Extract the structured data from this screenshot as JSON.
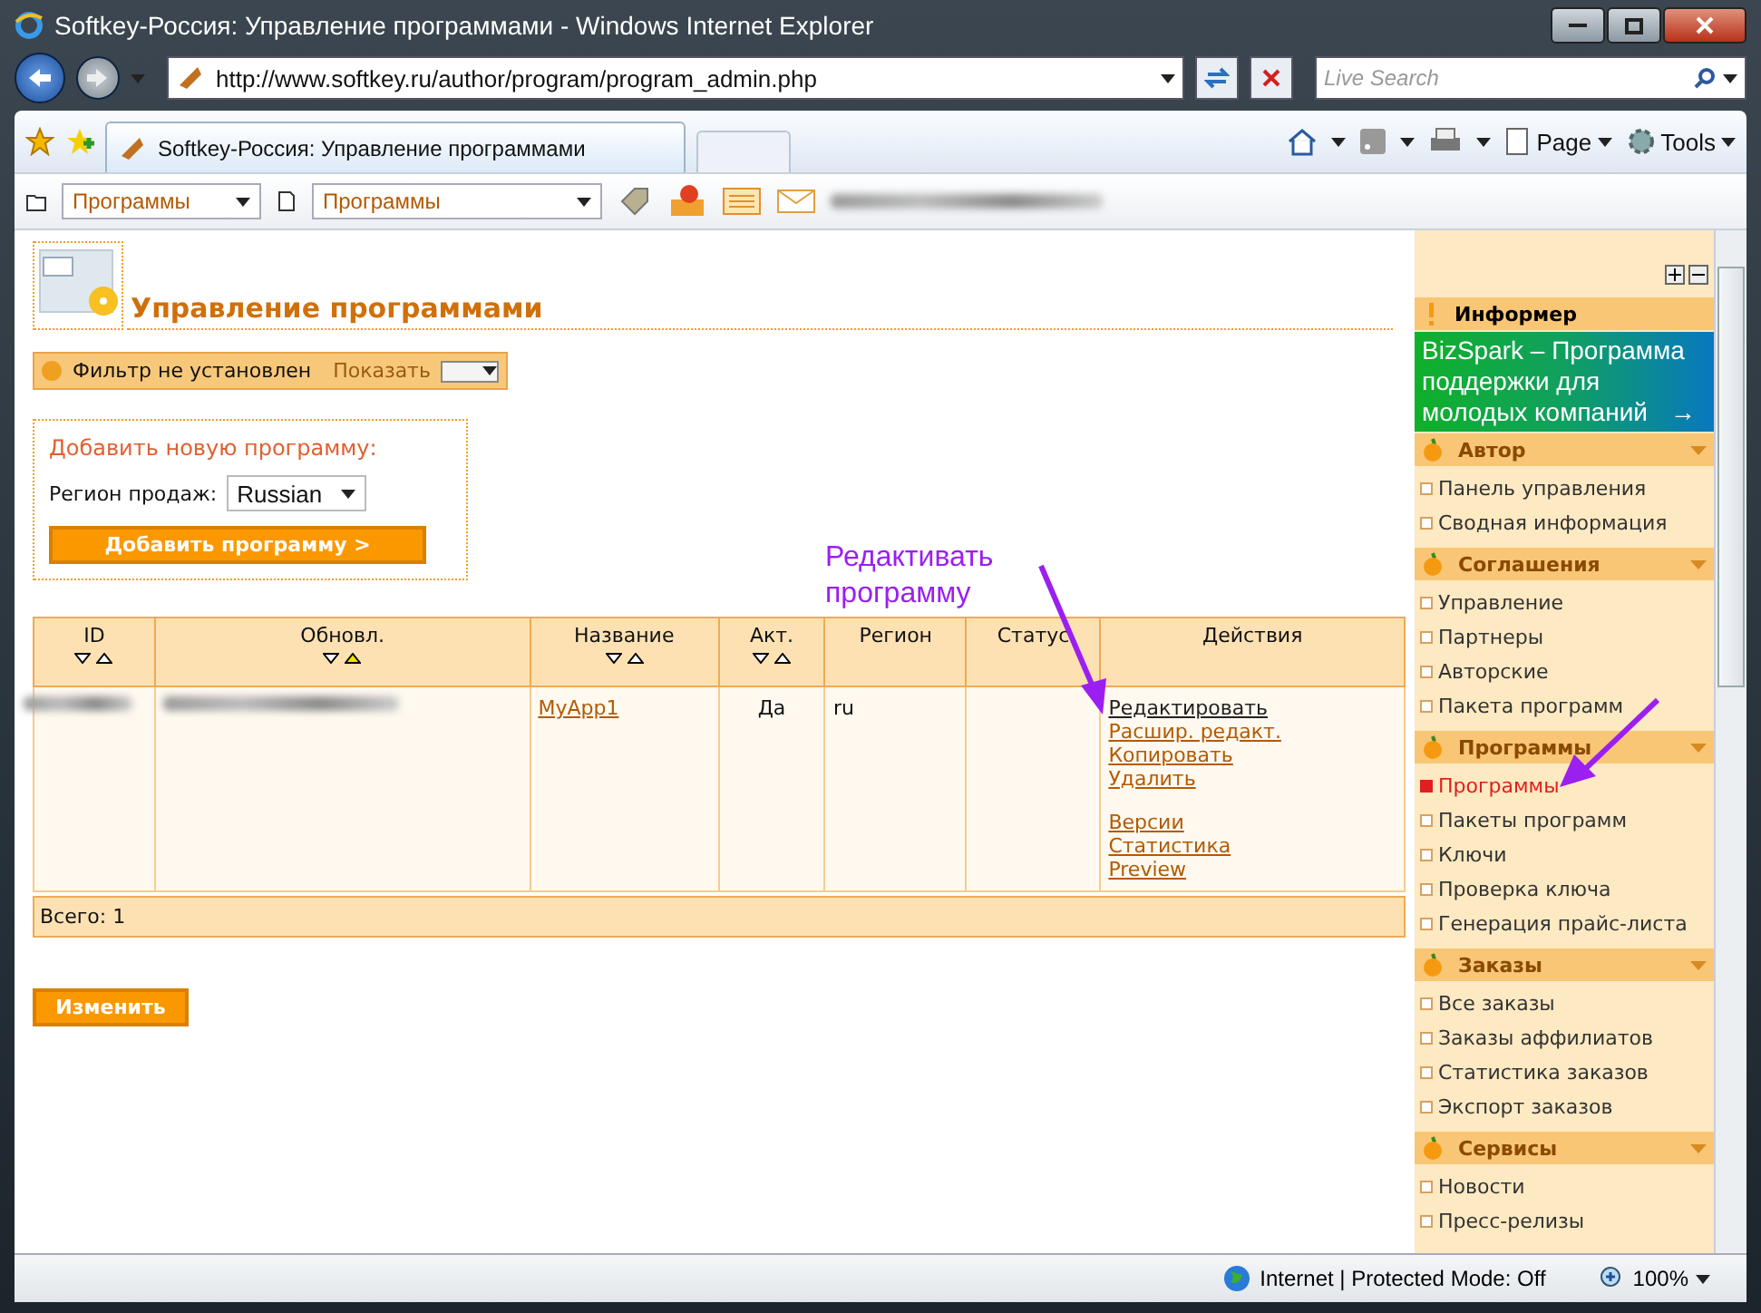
{
  "window": {
    "title": "Softkey-Россия: Управление программами - Windows Internet Explorer"
  },
  "address_bar": {
    "url": "http://www.softkey.ru/author/program/program_admin.php",
    "search_placeholder": "Live Search"
  },
  "tab": {
    "title": "Softkey-Россия: Управление программами"
  },
  "command_bar": {
    "page": "Page",
    "tools": "Tools"
  },
  "site_toolbar": {
    "dropdowns": [
      "Программы",
      "Программы"
    ]
  },
  "page": {
    "heading": "Управление программами",
    "filter": {
      "status": "Фильтр не установлен",
      "show_label": "Показать"
    },
    "add_program": {
      "title": "Добавить новую программу:",
      "region_label": "Регион продаж:",
      "region_value": "Russian",
      "button": "Добавить программу >"
    },
    "table": {
      "columns": [
        {
          "label": "ID",
          "sortable": true,
          "sort_highlighted": false
        },
        {
          "label": "Обновл.",
          "sortable": true,
          "sort_highlighted": true
        },
        {
          "label": "Название",
          "sortable": true,
          "sort_highlighted": false
        },
        {
          "label": "Акт.",
          "sortable": true,
          "sort_highlighted": false
        },
        {
          "label": "Регион",
          "sortable": false
        },
        {
          "label": "Статус",
          "sortable": false
        },
        {
          "label": "Действия",
          "sortable": false
        }
      ],
      "rows": [
        {
          "name": "MyApp1",
          "active": "Да",
          "region": "ru",
          "action_groups": [
            [
              {
                "label": "Редактировать",
                "selected": true
              },
              {
                "label": "Расшир. редакт.",
                "selected": false
              },
              {
                "label": "Копировать",
                "selected": false
              },
              {
                "label": "Удалить",
                "selected": false
              }
            ],
            [
              {
                "label": "Версии",
                "selected": false
              },
              {
                "label": "Статистика",
                "selected": false
              },
              {
                "label": "Preview",
                "selected": false
              }
            ]
          ]
        }
      ],
      "footer": "Всего: 1"
    },
    "submit_button": "Изменить",
    "annotation": "Редактивать программу"
  },
  "sidebar": {
    "informer": {
      "title": "Информер",
      "banner": "BizSpark – Программа поддержки для молодых компаний",
      "banner_arrow": "→"
    },
    "sections": [
      {
        "title": "Автор",
        "items": [
          {
            "label": "Панель управления",
            "selected": false
          },
          {
            "label": "Сводная информация",
            "selected": false
          }
        ]
      },
      {
        "title": "Соглашения",
        "items": [
          {
            "label": "Управление",
            "selected": false
          },
          {
            "label": "Партнеры",
            "selected": false
          },
          {
            "label": "Авторские",
            "selected": false
          },
          {
            "label": "Пакета программ",
            "selected": false
          }
        ]
      },
      {
        "title": "Программы",
        "items": [
          {
            "label": "Программы",
            "selected": true
          },
          {
            "label": "Пакеты программ",
            "selected": false
          },
          {
            "label": "Ключи",
            "selected": false
          },
          {
            "label": "Проверка ключа",
            "selected": false
          },
          {
            "label": "Генерация прайс-листа",
            "selected": false
          }
        ]
      },
      {
        "title": "Заказы",
        "items": [
          {
            "label": "Все заказы",
            "selected": false
          },
          {
            "label": "Заказы аффилиатов",
            "selected": false
          },
          {
            "label": "Статистика заказов",
            "selected": false
          },
          {
            "label": "Экспорт заказов",
            "selected": false
          }
        ]
      },
      {
        "title": "Сервисы",
        "items": [
          {
            "label": "Новости",
            "selected": false
          },
          {
            "label": "Пресс-релизы",
            "selected": false
          }
        ]
      }
    ]
  },
  "status_bar": {
    "zone": "Internet | Protected Mode: Off",
    "zoom": "100%"
  }
}
